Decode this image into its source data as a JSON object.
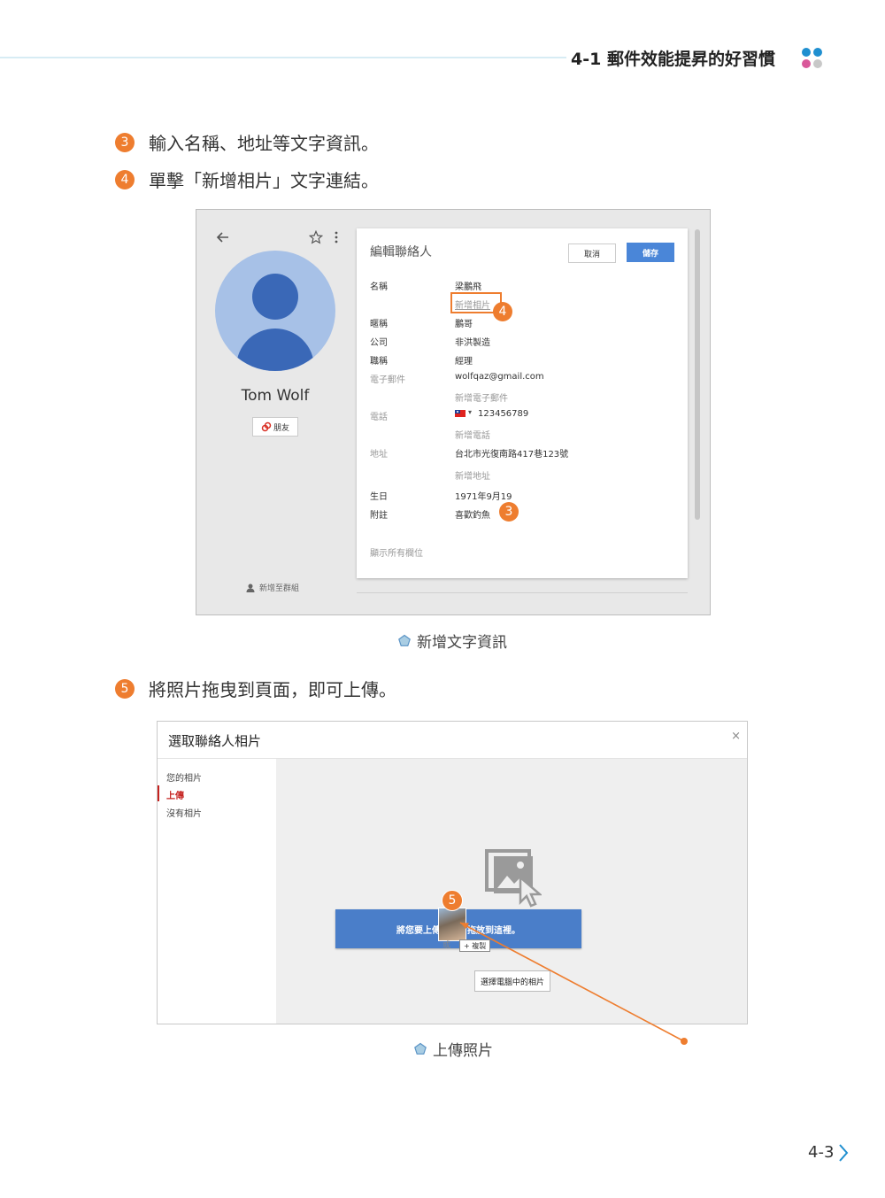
{
  "header": {
    "title": "4-1  郵件效能提昇的好習慣",
    "dot_colors": [
      "#1f8fd0",
      "#1f8fd0",
      "#d9589a",
      "#c8c8c8"
    ]
  },
  "steps": [
    {
      "num": "3",
      "text": "輸入名稱、地址等文字資訊。"
    },
    {
      "num": "4",
      "text": "單擊「新增相片」文字連結。"
    },
    {
      "num": "5",
      "text": "將照片拖曳到頁面，即可上傳。"
    }
  ],
  "figure1": {
    "contact_name": "Tom Wolf",
    "group_label": "朋友",
    "add_to_group": "新增至群組",
    "card_title": "編輯聯絡人",
    "cancel_label": "取消",
    "save_label": "儲存",
    "fields": [
      {
        "label": "名稱",
        "value": "梁鵬飛"
      },
      {
        "label": "",
        "value": "新增相片"
      },
      {
        "label": "暱稱",
        "value": "鵬哥"
      },
      {
        "label": "公司",
        "value": "非洪製造"
      },
      {
        "label": "職稱",
        "value": "經理"
      },
      {
        "label": "電子郵件",
        "value": "wolfqaz@gmail.com"
      },
      {
        "label": "",
        "value": "新增電子郵件"
      },
      {
        "label": "電話",
        "value": "123456789"
      },
      {
        "label": "",
        "value": "新增電話"
      },
      {
        "label": "地址",
        "value": "台北市光復南路417巷123號"
      },
      {
        "label": "",
        "value": "新增地址"
      },
      {
        "label": "生日",
        "value": "1971年9月19"
      },
      {
        "label": "附註",
        "value": "喜歡釣魚"
      }
    ],
    "show_all_fields": "顯示所有欄位",
    "badge_add_photo": "4",
    "badge_note": "3",
    "caption": "新增文字資訊"
  },
  "figure2": {
    "title": "選取聯絡人相片",
    "close": "×",
    "side_items": [
      "您的相片",
      "上傳",
      "沒有相片"
    ],
    "drop_text": "將您要上傳的相片拖放到這裡。",
    "copy_label": "+ 複製",
    "or_text": "或",
    "choose_label": "選擇電腦中的相片",
    "badge": "5",
    "caption": "上傳照片",
    "active_color": "#c5221f"
  },
  "page_number": "4-3"
}
